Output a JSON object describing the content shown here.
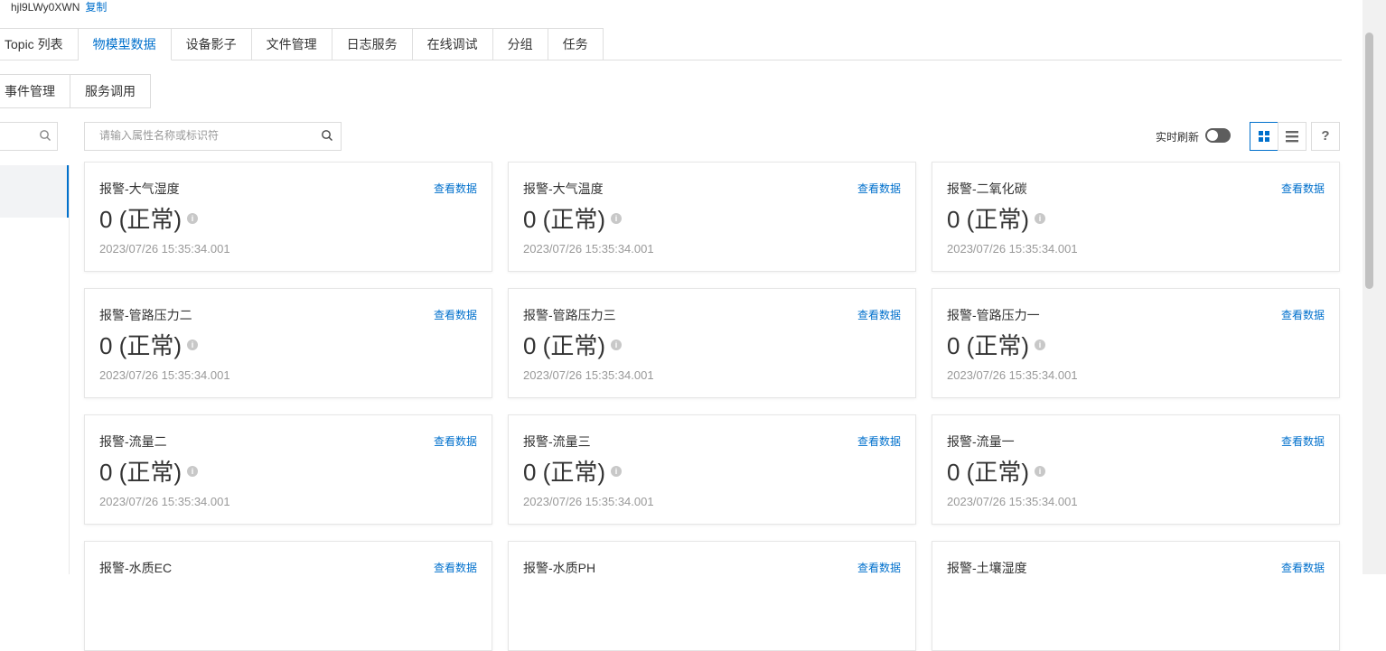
{
  "device": {
    "id": "hjl9LWy0XWN",
    "copy_label": "复制"
  },
  "tabs": [
    {
      "label": "Topic 列表",
      "active": false
    },
    {
      "label": "物模型数据",
      "active": true
    },
    {
      "label": "设备影子",
      "active": false
    },
    {
      "label": "文件管理",
      "active": false
    },
    {
      "label": "日志服务",
      "active": false
    },
    {
      "label": "在线调试",
      "active": false
    },
    {
      "label": "分组",
      "active": false
    },
    {
      "label": "任务",
      "active": false
    }
  ],
  "subtabs": [
    {
      "label": "事件管理"
    },
    {
      "label": "服务调用"
    }
  ],
  "search": {
    "placeholder": "请输入属性名称或标识符",
    "value": ""
  },
  "toolbar": {
    "realtime_label": "实时刷新",
    "realtime_on": false,
    "help_label": "?",
    "view_mode": "grid"
  },
  "colors": {
    "accent": "#0070cc",
    "text": "#333333",
    "muted": "#999999",
    "border": "#e6e6e6"
  },
  "cards": [
    {
      "name": "报警-大气湿度",
      "value": "0 (正常)",
      "time": "2023/07/26 15:35:34.001",
      "link": "查看数据"
    },
    {
      "name": "报警-大气温度",
      "value": "0 (正常)",
      "time": "2023/07/26 15:35:34.001",
      "link": "查看数据"
    },
    {
      "name": "报警-二氧化碳",
      "value": "0 (正常)",
      "time": "2023/07/26 15:35:34.001",
      "link": "查看数据"
    },
    {
      "name": "报警-管路压力二",
      "value": "0 (正常)",
      "time": "2023/07/26 15:35:34.001",
      "link": "查看数据"
    },
    {
      "name": "报警-管路压力三",
      "value": "0 (正常)",
      "time": "2023/07/26 15:35:34.001",
      "link": "查看数据"
    },
    {
      "name": "报警-管路压力一",
      "value": "0 (正常)",
      "time": "2023/07/26 15:35:34.001",
      "link": "查看数据"
    },
    {
      "name": "报警-流量二",
      "value": "0 (正常)",
      "time": "2023/07/26 15:35:34.001",
      "link": "查看数据"
    },
    {
      "name": "报警-流量三",
      "value": "0 (正常)",
      "time": "2023/07/26 15:35:34.001",
      "link": "查看数据"
    },
    {
      "name": "报警-流量一",
      "value": "0 (正常)",
      "time": "2023/07/26 15:35:34.001",
      "link": "查看数据"
    },
    {
      "name": "报警-水质EC",
      "value": "",
      "time": "",
      "link": "查看数据"
    },
    {
      "name": "报警-水质PH",
      "value": "",
      "time": "",
      "link": "查看数据"
    },
    {
      "name": "报警-土壤湿度",
      "value": "",
      "time": "",
      "link": "查看数据"
    }
  ]
}
